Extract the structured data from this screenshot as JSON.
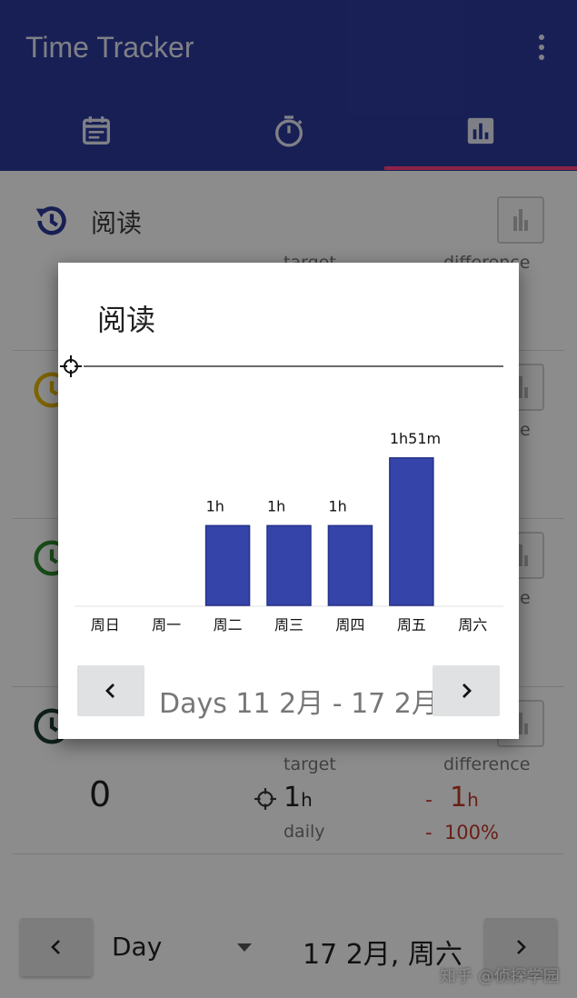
{
  "app": {
    "title": "Time Tracker",
    "tabs": [
      {
        "icon": "calendar-icon"
      },
      {
        "icon": "stopwatch-icon"
      },
      {
        "icon": "bar-chart-icon",
        "selected": true
      }
    ],
    "accent_color": "#2d3a9b",
    "indicator_color": "#ff4081"
  },
  "rows": [
    {
      "name": "阅读",
      "icon_color": "#2d3a9b",
      "target_label": "target",
      "difference_label": "difference"
    },
    {
      "icon_color": "#e5b600",
      "difference_label_partial": "e"
    },
    {
      "icon_color": "#2e8b2e",
      "difference_label_partial": "e"
    },
    {
      "icon_color": "#1f3b32",
      "count": "0",
      "target_label": "target",
      "difference_label": "difference",
      "target_value": "1",
      "target_unit": "h",
      "period_label": "daily",
      "diff_sign": "-",
      "diff_value": "1",
      "diff_unit": "h",
      "diff_percent_sign": "-",
      "diff_percent": "100%"
    }
  ],
  "bottom": {
    "period": "Day",
    "date": "17 2月, 周六"
  },
  "watermark": "知乎 @侦探学园",
  "dialog": {
    "title": "阅读",
    "range": "Days 11 2月 - 17 2月",
    "prev_label": "‹",
    "next_label": "›"
  },
  "chart_data": {
    "type": "bar",
    "categories": [
      "周日",
      "周一",
      "周二",
      "周三",
      "周四",
      "周五",
      "周六"
    ],
    "values": [
      0,
      0,
      60,
      60,
      60,
      111,
      0
    ],
    "value_unit": "minutes",
    "data_labels": [
      "",
      "",
      "1h",
      "1h",
      "1h",
      "1h51m",
      ""
    ],
    "target_line": 180,
    "ylim": [
      0,
      180
    ],
    "bar_color": "#3544a8",
    "grid": false,
    "legend": "none"
  }
}
